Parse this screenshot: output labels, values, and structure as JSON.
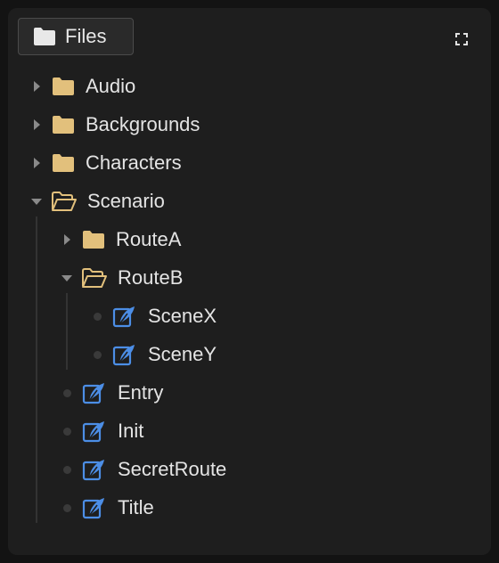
{
  "header": {
    "files_label": "Files",
    "files_icon": "folder-icon",
    "expand_icon": "expand-icon"
  },
  "colors": {
    "folder": "#e2c07c",
    "script_icon": "#4c8ee6",
    "text": "#e4e4e4",
    "panel": "#1e1e1e"
  },
  "tree": {
    "items": [
      {
        "label": "Audio",
        "type": "folder",
        "expanded": false
      },
      {
        "label": "Backgrounds",
        "type": "folder",
        "expanded": false
      },
      {
        "label": "Characters",
        "type": "folder",
        "expanded": false
      },
      {
        "label": "Scenario",
        "type": "folder",
        "expanded": true,
        "children": [
          {
            "label": "RouteA",
            "type": "folder",
            "expanded": false
          },
          {
            "label": "RouteB",
            "type": "folder",
            "expanded": true,
            "children": [
              {
                "label": "SceneX",
                "type": "script"
              },
              {
                "label": "SceneY",
                "type": "script"
              }
            ]
          },
          {
            "label": "Entry",
            "type": "script"
          },
          {
            "label": "Init",
            "type": "script"
          },
          {
            "label": "SecretRoute",
            "type": "script"
          },
          {
            "label": "Title",
            "type": "script"
          }
        ]
      }
    ]
  }
}
